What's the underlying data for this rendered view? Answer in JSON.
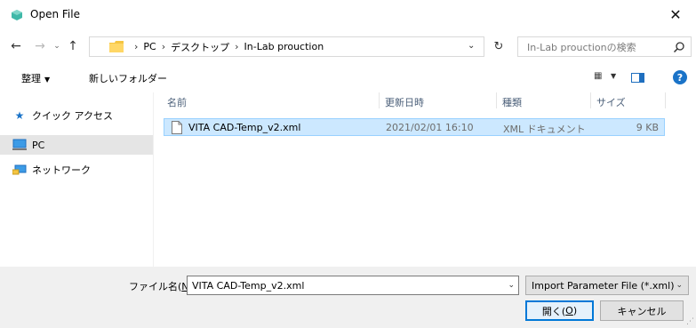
{
  "window": {
    "title": "Open File",
    "close_glyph": "✕"
  },
  "navigation": {
    "back_glyph": "←",
    "forward_glyph": "→",
    "recent_glyph": "⌄",
    "up_glyph": "↑",
    "breadcrumb": [
      "PC",
      "デスクトップ",
      "In-Lab prouction"
    ],
    "breadcrumb_sep": "›",
    "dropdown_glyph": "⌄",
    "refresh_glyph": "↻",
    "search_placeholder": "In-Lab prouctionの検索"
  },
  "toolbar": {
    "organize_label": "整理",
    "organize_caret": "▼",
    "new_folder_label": "新しいフォルダー",
    "view_glyph": "▦",
    "view_caret": "▼",
    "help_glyph": "?"
  },
  "sidebar": {
    "items": [
      {
        "label": "クイック アクセス",
        "icon": "star-icon",
        "glyph": "★",
        "color": "#1a73c8"
      },
      {
        "label": "PC",
        "icon": "computer-icon",
        "glyph": "",
        "color": "#3c9be6",
        "selected": true
      },
      {
        "label": "ネットワーク",
        "icon": "network-icon",
        "glyph": "",
        "color": "#3c9be6"
      }
    ]
  },
  "file_list": {
    "columns": [
      "名前",
      "更新日時",
      "種類",
      "サイズ"
    ],
    "rows": [
      {
        "name": "VITA CAD-Temp_v2.xml",
        "modified": "2021/02/01 16:10",
        "type": "XML ドキュメント",
        "size": "9 KB",
        "selected": true
      }
    ]
  },
  "footer": {
    "filename_label_prefix": "ファイル名(",
    "filename_label_accel": "N",
    "filename_label_suffix": "):",
    "filename_value": "VITA CAD-Temp_v2.xml",
    "filetype_value": "Import Parameter File (*.xml)",
    "open_label_prefix": "開く(",
    "open_label_accel": "O",
    "open_label_suffix": ")",
    "cancel_label": "キャンセル"
  },
  "colors": {
    "accent": "#0078d7",
    "selection_bg": "#cce8ff",
    "selection_border": "#99d1ff",
    "folder": "#f5c542"
  }
}
